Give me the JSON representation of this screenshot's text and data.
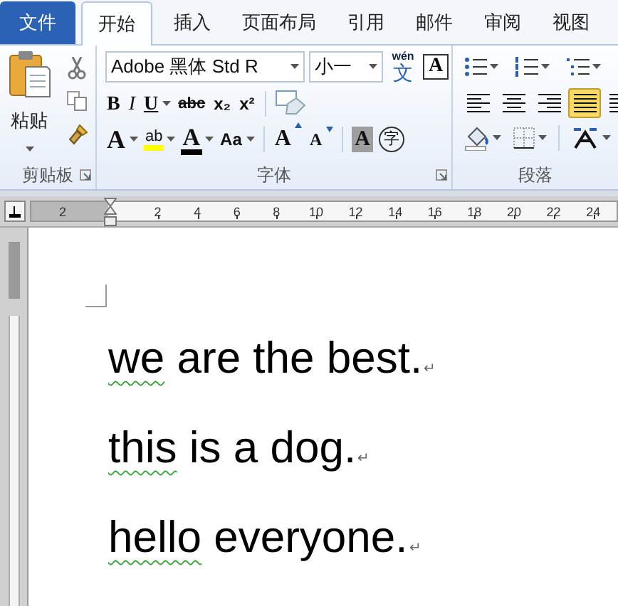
{
  "tabs": [
    {
      "label": "文件",
      "kind": "file",
      "selected": false
    },
    {
      "label": "开始",
      "kind": "tab",
      "selected": true
    },
    {
      "label": "插入",
      "kind": "tab",
      "selected": false
    },
    {
      "label": "页面布局",
      "kind": "tab",
      "selected": false
    },
    {
      "label": "引用",
      "kind": "tab",
      "selected": false
    },
    {
      "label": "邮件",
      "kind": "tab",
      "selected": false
    },
    {
      "label": "审阅",
      "kind": "tab",
      "selected": false
    },
    {
      "label": "视图",
      "kind": "tab",
      "selected": false
    }
  ],
  "clipboard": {
    "paste_label": "粘贴",
    "group_label": "剪贴板"
  },
  "font": {
    "font_name": "Adobe 黑体 Std R",
    "font_size": "小一",
    "pinyin_top": "wén",
    "pinyin_bottom": "文",
    "boxed": "A",
    "row2": [
      {
        "glyph": "B",
        "kind": "bold",
        "dropdown": false
      },
      {
        "glyph": "I",
        "kind": "italic",
        "dropdown": false
      },
      {
        "glyph": "U",
        "kind": "underline",
        "dropdown": true
      },
      {
        "glyph": "abc",
        "kind": "strike",
        "dropdown": false
      },
      {
        "glyph": "x₂",
        "kind": "plain",
        "dropdown": false
      },
      {
        "glyph": "x²",
        "kind": "plain",
        "dropdown": false
      }
    ],
    "row3": [
      {
        "glyph": "A",
        "kind": "effect",
        "dropdown": true
      },
      {
        "glyph": "ab",
        "kind": "highlight",
        "dropdown": true
      },
      {
        "glyph": "A",
        "kind": "color",
        "dropdown": true
      },
      {
        "glyph": "Aa",
        "kind": "plain",
        "dropdown": true
      },
      {
        "glyph": "A",
        "kind": "grow",
        "dropdown": false
      },
      {
        "glyph": "A",
        "kind": "shrink",
        "dropdown": false
      },
      {
        "glyph": "A",
        "kind": "shaded",
        "dropdown": false
      },
      {
        "glyph": "字",
        "kind": "circled",
        "dropdown": false
      }
    ],
    "group_label": "字体"
  },
  "paragraph": {
    "group_label": "段落",
    "alignments": [
      {
        "kind": "left",
        "selected": false
      },
      {
        "kind": "center",
        "selected": false
      },
      {
        "kind": "right",
        "selected": false
      },
      {
        "kind": "justify",
        "selected": true
      },
      {
        "kind": "distribute",
        "selected": false
      }
    ]
  },
  "ruler": {
    "ticks": [
      "2",
      "2",
      "4",
      "6",
      "8",
      "10",
      "12",
      "14",
      "16",
      "18",
      "20",
      "22",
      "24"
    ]
  },
  "document": {
    "lines": [
      {
        "segments": [
          {
            "text": "we",
            "flagged": true
          },
          {
            "text": " are the best.",
            "flagged": false
          }
        ],
        "mark": "↵"
      },
      {
        "segments": [
          {
            "text": "this",
            "flagged": true
          },
          {
            "text": " is a dog.",
            "flagged": false
          }
        ],
        "mark": "↵"
      },
      {
        "segments": [
          {
            "text": "hello",
            "flagged": true
          },
          {
            "text": " everyone.",
            "flagged": false
          }
        ],
        "mark": "↵"
      }
    ]
  }
}
